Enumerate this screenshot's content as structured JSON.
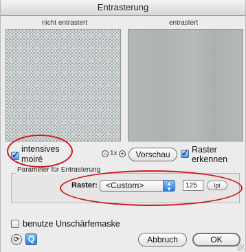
{
  "window": {
    "title": "Entrasterung"
  },
  "preview": {
    "left_label": "nicht entrastert",
    "right_label": "entrastert"
  },
  "controls": {
    "intensive_moire": {
      "line1": "intensives",
      "line2": "moiré",
      "checked": true
    },
    "zoom": {
      "minus_icon": "zoom-out-icon",
      "level": "1x",
      "plus_icon": "zoom-in-icon"
    },
    "preview_button": "Vorschau",
    "detect_raster": {
      "line1": "Raster",
      "line2": "erkennen",
      "checked": true
    }
  },
  "parameters": {
    "group_label": "Parameter für Entrasterung",
    "raster_label": "Raster:",
    "raster_select_value": "<Custom>",
    "raster_value": "125",
    "unit_label": "lpi"
  },
  "unsharp_mask": {
    "label": "benutze Unschärfemaske",
    "checked": false
  },
  "footer": {
    "cancel_button": "Abbruch",
    "ok_button": "OK",
    "icons": [
      "preview-mode-icon",
      "zoom-tool-icon"
    ]
  },
  "annotation_color": "#d0181a"
}
